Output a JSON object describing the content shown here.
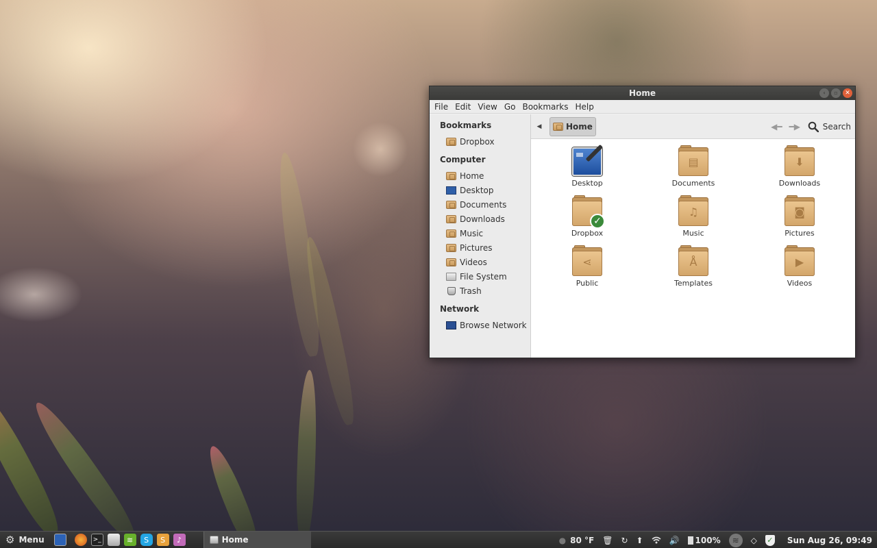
{
  "window": {
    "title": "Home",
    "menu": [
      "File",
      "Edit",
      "View",
      "Go",
      "Bookmarks",
      "Help"
    ],
    "sidebar": {
      "sections": [
        {
          "heading": "Bookmarks",
          "items": [
            {
              "label": "Dropbox",
              "icon": "folder-icon"
            }
          ]
        },
        {
          "heading": "Computer",
          "items": [
            {
              "label": "Home",
              "icon": "home-folder-icon"
            },
            {
              "label": "Desktop",
              "icon": "desktop-icon"
            },
            {
              "label": "Documents",
              "icon": "documents-folder-icon"
            },
            {
              "label": "Downloads",
              "icon": "downloads-folder-icon"
            },
            {
              "label": "Music",
              "icon": "music-folder-icon"
            },
            {
              "label": "Pictures",
              "icon": "pictures-folder-icon"
            },
            {
              "label": "Videos",
              "icon": "videos-folder-icon"
            },
            {
              "label": "File System",
              "icon": "drive-icon"
            },
            {
              "label": "Trash",
              "icon": "trash-icon"
            }
          ]
        },
        {
          "heading": "Network",
          "items": [
            {
              "label": "Browse Network",
              "icon": "network-icon"
            }
          ]
        }
      ]
    },
    "toolbar": {
      "breadcrumb": "Home",
      "search_label": "Search"
    },
    "files": [
      {
        "label": "Desktop",
        "icon": "desktop-icon"
      },
      {
        "label": "Documents",
        "icon": "documents-folder-icon"
      },
      {
        "label": "Downloads",
        "icon": "downloads-folder-icon"
      },
      {
        "label": "Dropbox",
        "icon": "dropbox-folder-icon"
      },
      {
        "label": "Music",
        "icon": "music-folder-icon"
      },
      {
        "label": "Pictures",
        "icon": "pictures-folder-icon"
      },
      {
        "label": "Public",
        "icon": "public-folder-icon"
      },
      {
        "label": "Templates",
        "icon": "templates-folder-icon"
      },
      {
        "label": "Videos",
        "icon": "videos-folder-icon"
      }
    ]
  },
  "panel": {
    "menu_label": "Menu",
    "task": "Home",
    "weather": "80 °F",
    "battery": "100%",
    "clock": "Sun Aug 26, 09:49"
  },
  "colors": {
    "folder": "#d3a66a",
    "close_button": "#e0603a",
    "panel": "#2f2f2f",
    "dropbox_check": "#3b8a3a"
  }
}
